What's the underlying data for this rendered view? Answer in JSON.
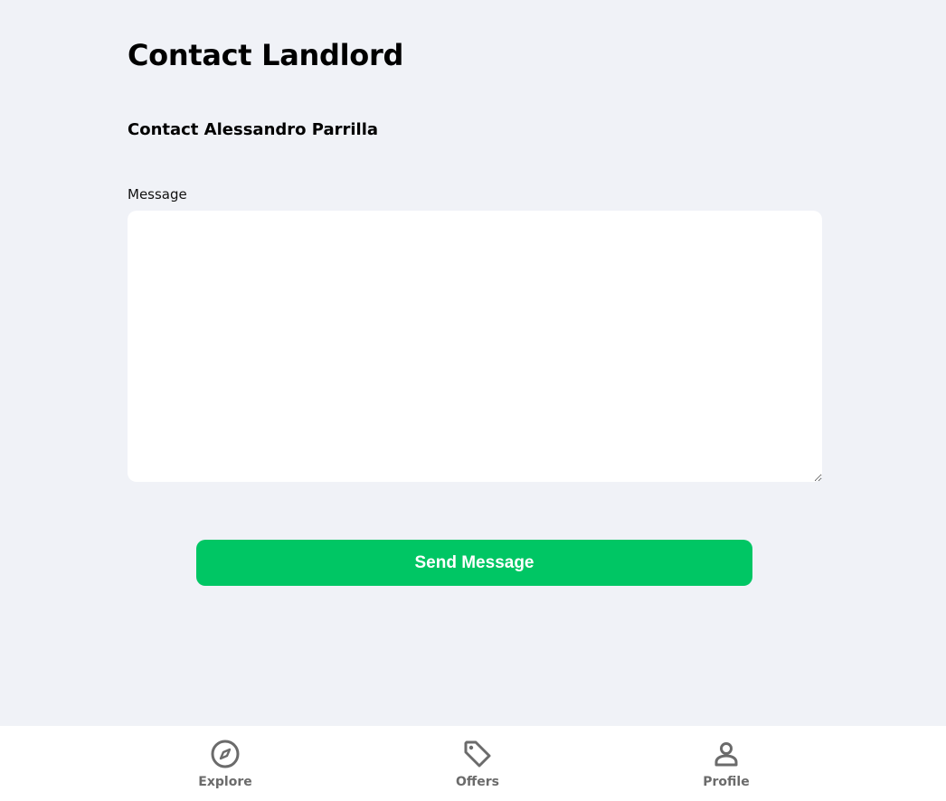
{
  "page": {
    "title": "Contact Landlord",
    "subtitle": "Contact Alessandro Parrilla"
  },
  "form": {
    "message_label": "Message",
    "message_value": "",
    "send_label": "Send Message"
  },
  "colors": {
    "background": "#f0f2f7",
    "accent": "#00c664",
    "nav_text": "#6b6b6b"
  },
  "bottom_nav": {
    "items": [
      {
        "label": "Explore",
        "icon": "compass-icon"
      },
      {
        "label": "Offers",
        "icon": "tag-icon"
      },
      {
        "label": "Profile",
        "icon": "person-icon"
      }
    ]
  }
}
